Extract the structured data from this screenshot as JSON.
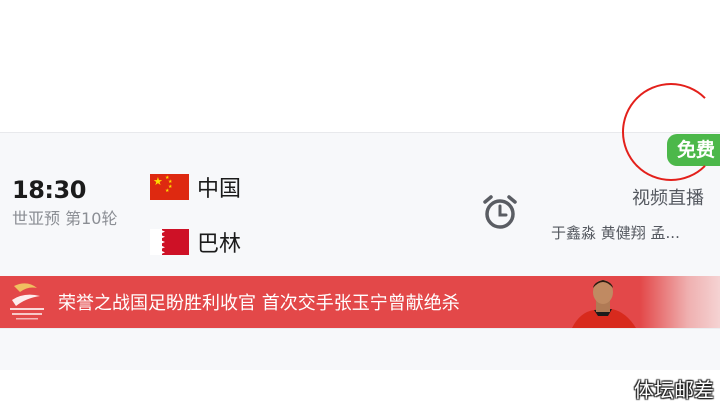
{
  "match": {
    "time": "18:30",
    "league": "世亚预 第10轮",
    "home_team": "中国",
    "away_team": "巴林",
    "home_flag_icon": "china-flag-icon",
    "away_flag_icon": "bahrain-flag-icon",
    "alarm_icon": "alarm-clock-icon",
    "free_badge": "免费",
    "broadcast_label": "视频直播",
    "commentators": "于鑫淼 黄健翔 孟..."
  },
  "banner": {
    "text": "荣誉之战国足盼胜利收官 首次交手张玉宁曾献绝杀",
    "logo_icon": "asian-qualifiers-logo",
    "player_image": "player-photo",
    "color": "#e34849"
  },
  "watermark": "体坛邮差",
  "colors": {
    "free_badge": "#4cb84a",
    "annotation_circle": "#e3201b"
  }
}
